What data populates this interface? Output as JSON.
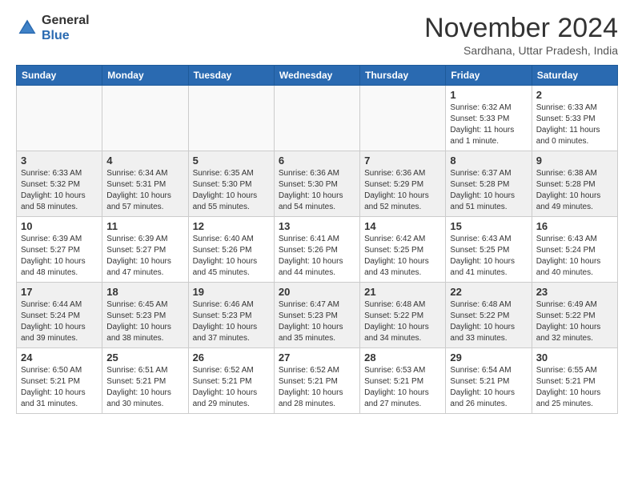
{
  "logo": {
    "line1": "General",
    "line2": "Blue"
  },
  "title": "November 2024",
  "subtitle": "Sardhana, Uttar Pradesh, India",
  "weekdays": [
    "Sunday",
    "Monday",
    "Tuesday",
    "Wednesday",
    "Thursday",
    "Friday",
    "Saturday"
  ],
  "weeks": [
    [
      {
        "day": "",
        "info": ""
      },
      {
        "day": "",
        "info": ""
      },
      {
        "day": "",
        "info": ""
      },
      {
        "day": "",
        "info": ""
      },
      {
        "day": "",
        "info": ""
      },
      {
        "day": "1",
        "info": "Sunrise: 6:32 AM\nSunset: 5:33 PM\nDaylight: 11 hours\nand 1 minute."
      },
      {
        "day": "2",
        "info": "Sunrise: 6:33 AM\nSunset: 5:33 PM\nDaylight: 11 hours\nand 0 minutes."
      }
    ],
    [
      {
        "day": "3",
        "info": "Sunrise: 6:33 AM\nSunset: 5:32 PM\nDaylight: 10 hours\nand 58 minutes."
      },
      {
        "day": "4",
        "info": "Sunrise: 6:34 AM\nSunset: 5:31 PM\nDaylight: 10 hours\nand 57 minutes."
      },
      {
        "day": "5",
        "info": "Sunrise: 6:35 AM\nSunset: 5:30 PM\nDaylight: 10 hours\nand 55 minutes."
      },
      {
        "day": "6",
        "info": "Sunrise: 6:36 AM\nSunset: 5:30 PM\nDaylight: 10 hours\nand 54 minutes."
      },
      {
        "day": "7",
        "info": "Sunrise: 6:36 AM\nSunset: 5:29 PM\nDaylight: 10 hours\nand 52 minutes."
      },
      {
        "day": "8",
        "info": "Sunrise: 6:37 AM\nSunset: 5:28 PM\nDaylight: 10 hours\nand 51 minutes."
      },
      {
        "day": "9",
        "info": "Sunrise: 6:38 AM\nSunset: 5:28 PM\nDaylight: 10 hours\nand 49 minutes."
      }
    ],
    [
      {
        "day": "10",
        "info": "Sunrise: 6:39 AM\nSunset: 5:27 PM\nDaylight: 10 hours\nand 48 minutes."
      },
      {
        "day": "11",
        "info": "Sunrise: 6:39 AM\nSunset: 5:27 PM\nDaylight: 10 hours\nand 47 minutes."
      },
      {
        "day": "12",
        "info": "Sunrise: 6:40 AM\nSunset: 5:26 PM\nDaylight: 10 hours\nand 45 minutes."
      },
      {
        "day": "13",
        "info": "Sunrise: 6:41 AM\nSunset: 5:26 PM\nDaylight: 10 hours\nand 44 minutes."
      },
      {
        "day": "14",
        "info": "Sunrise: 6:42 AM\nSunset: 5:25 PM\nDaylight: 10 hours\nand 43 minutes."
      },
      {
        "day": "15",
        "info": "Sunrise: 6:43 AM\nSunset: 5:25 PM\nDaylight: 10 hours\nand 41 minutes."
      },
      {
        "day": "16",
        "info": "Sunrise: 6:43 AM\nSunset: 5:24 PM\nDaylight: 10 hours\nand 40 minutes."
      }
    ],
    [
      {
        "day": "17",
        "info": "Sunrise: 6:44 AM\nSunset: 5:24 PM\nDaylight: 10 hours\nand 39 minutes."
      },
      {
        "day": "18",
        "info": "Sunrise: 6:45 AM\nSunset: 5:23 PM\nDaylight: 10 hours\nand 38 minutes."
      },
      {
        "day": "19",
        "info": "Sunrise: 6:46 AM\nSunset: 5:23 PM\nDaylight: 10 hours\nand 37 minutes."
      },
      {
        "day": "20",
        "info": "Sunrise: 6:47 AM\nSunset: 5:23 PM\nDaylight: 10 hours\nand 35 minutes."
      },
      {
        "day": "21",
        "info": "Sunrise: 6:48 AM\nSunset: 5:22 PM\nDaylight: 10 hours\nand 34 minutes."
      },
      {
        "day": "22",
        "info": "Sunrise: 6:48 AM\nSunset: 5:22 PM\nDaylight: 10 hours\nand 33 minutes."
      },
      {
        "day": "23",
        "info": "Sunrise: 6:49 AM\nSunset: 5:22 PM\nDaylight: 10 hours\nand 32 minutes."
      }
    ],
    [
      {
        "day": "24",
        "info": "Sunrise: 6:50 AM\nSunset: 5:21 PM\nDaylight: 10 hours\nand 31 minutes."
      },
      {
        "day": "25",
        "info": "Sunrise: 6:51 AM\nSunset: 5:21 PM\nDaylight: 10 hours\nand 30 minutes."
      },
      {
        "day": "26",
        "info": "Sunrise: 6:52 AM\nSunset: 5:21 PM\nDaylight: 10 hours\nand 29 minutes."
      },
      {
        "day": "27",
        "info": "Sunrise: 6:52 AM\nSunset: 5:21 PM\nDaylight: 10 hours\nand 28 minutes."
      },
      {
        "day": "28",
        "info": "Sunrise: 6:53 AM\nSunset: 5:21 PM\nDaylight: 10 hours\nand 27 minutes."
      },
      {
        "day": "29",
        "info": "Sunrise: 6:54 AM\nSunset: 5:21 PM\nDaylight: 10 hours\nand 26 minutes."
      },
      {
        "day": "30",
        "info": "Sunrise: 6:55 AM\nSunset: 5:21 PM\nDaylight: 10 hours\nand 25 minutes."
      }
    ]
  ]
}
